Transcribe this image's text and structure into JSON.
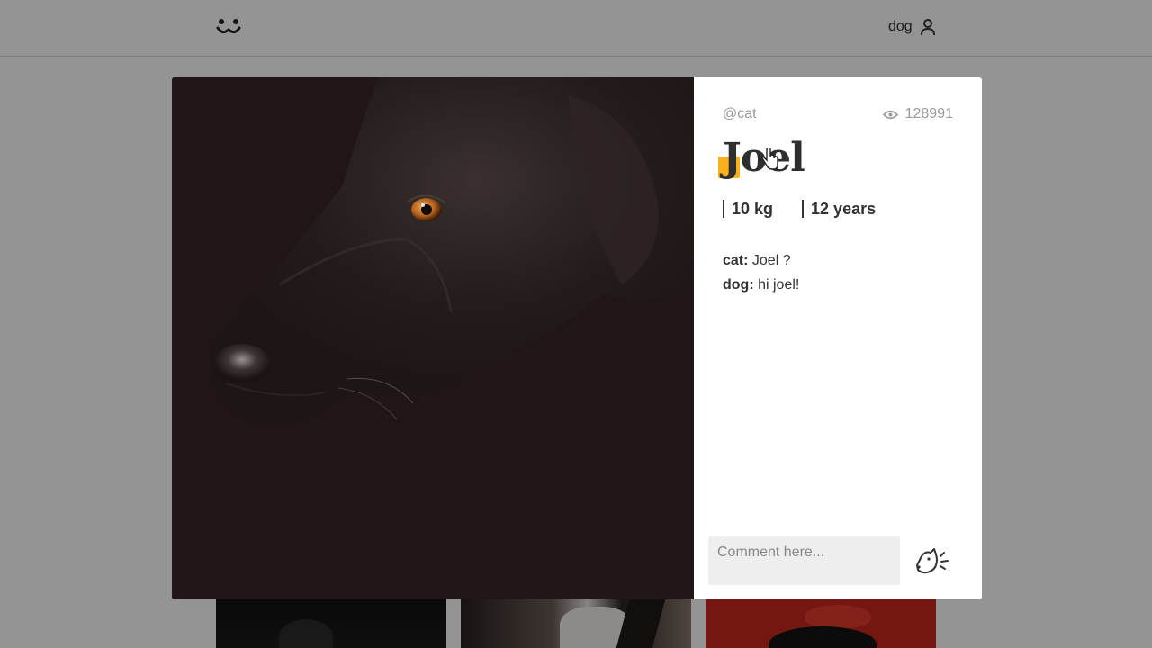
{
  "header": {
    "logo_icon": "dog-face-logo-icon",
    "account_label": "dog",
    "account_icon": "user-icon"
  },
  "photo": {
    "alt": "Joel"
  },
  "details": {
    "author": "@cat",
    "views_icon": "eye-icon",
    "views": "128991",
    "title": "Joel",
    "accent_color": "#fbb11b",
    "weight": "10 kg",
    "age": "12 years",
    "comments": [
      {
        "author": "cat:",
        "text": " Joel ?"
      },
      {
        "author": "dog:",
        "text": " hi joel!"
      }
    ]
  },
  "comment_form": {
    "placeholder": "Comment here...",
    "send_icon": "dog-bark-send-icon"
  }
}
